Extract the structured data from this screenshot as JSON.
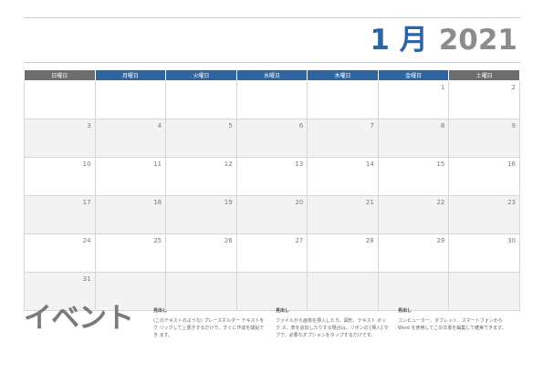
{
  "header": {
    "month": "1 月",
    "year": "2021"
  },
  "weekdays": [
    "日曜日",
    "月曜日",
    "火曜日",
    "水曜日",
    "木曜日",
    "金曜日",
    "土曜日"
  ],
  "weeks": [
    [
      "",
      "",
      "",
      "",
      "",
      "1",
      "2"
    ],
    [
      "3",
      "4",
      "5",
      "6",
      "7",
      "8",
      "9"
    ],
    [
      "10",
      "11",
      "12",
      "13",
      "14",
      "15",
      "16"
    ],
    [
      "17",
      "18",
      "19",
      "20",
      "21",
      "22",
      "23"
    ],
    [
      "24",
      "25",
      "26",
      "27",
      "28",
      "29",
      "30"
    ],
    [
      "31",
      "",
      "",
      "",
      "",
      "",
      ""
    ]
  ],
  "events": {
    "title": "イベント",
    "items": [
      {
        "heading": "見出し",
        "body": "(このテキストのような) プレースホルダー テキストをク リックして上書きするだけで、すぐに作成を開始でき ます。"
      },
      {
        "heading": "見出し",
        "body": "ファイルから画像を挿入したり、図形、テキスト ボック ス、表を追加したりする場合は、リボンの [挿入] タ ブで、必要なオプションをタップするだけです。"
      },
      {
        "heading": "見出し",
        "body": "コンピューター、タブレット、スマートフォンから Word を使用してこの文書を編集して確実できます。"
      }
    ]
  }
}
